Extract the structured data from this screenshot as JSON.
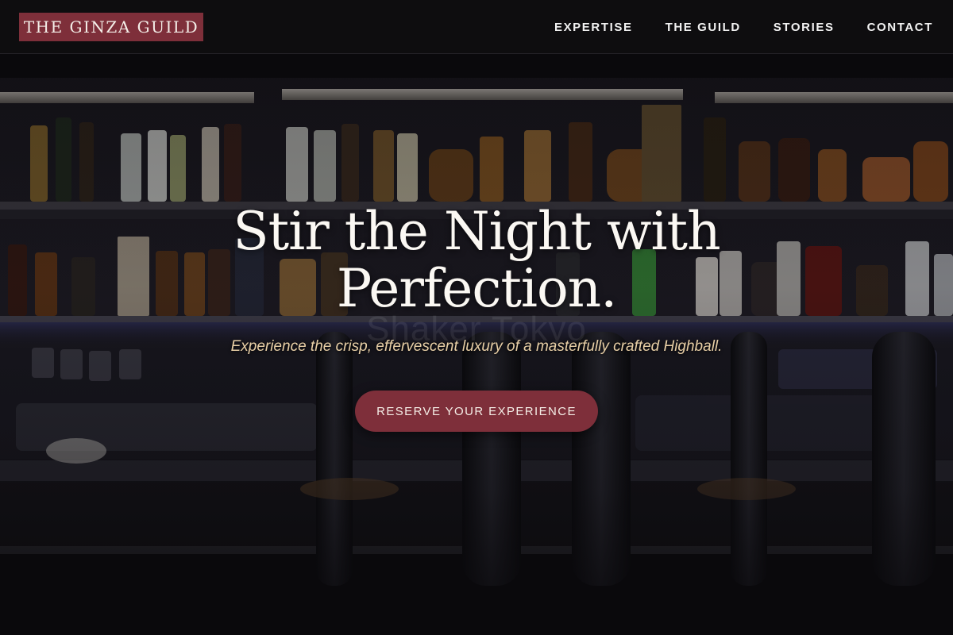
{
  "brand": {
    "name": "THE GINZA GUILD"
  },
  "nav": {
    "items": [
      {
        "label": "EXPERTISE"
      },
      {
        "label": "THE GUILD"
      },
      {
        "label": "STORIES"
      },
      {
        "label": "CONTACT"
      }
    ]
  },
  "hero": {
    "headline_line1": "Stir the Night with",
    "headline_line2": "Perfection.",
    "tagline": "Experience the crisp, effervescent luxury of a masterfully crafted Highball.",
    "cta_label": "RESERVE YOUR EXPERIENCE",
    "watermark": "Shaker Tokyo",
    "background_image": "bar-backshelf-with-bottles-and-beer-taps"
  },
  "colors": {
    "accent": "#7e2f3a",
    "tagline": "#e8cfa6",
    "header_bg": "#0e0d0f",
    "page_bg": "#0b0a0c"
  }
}
